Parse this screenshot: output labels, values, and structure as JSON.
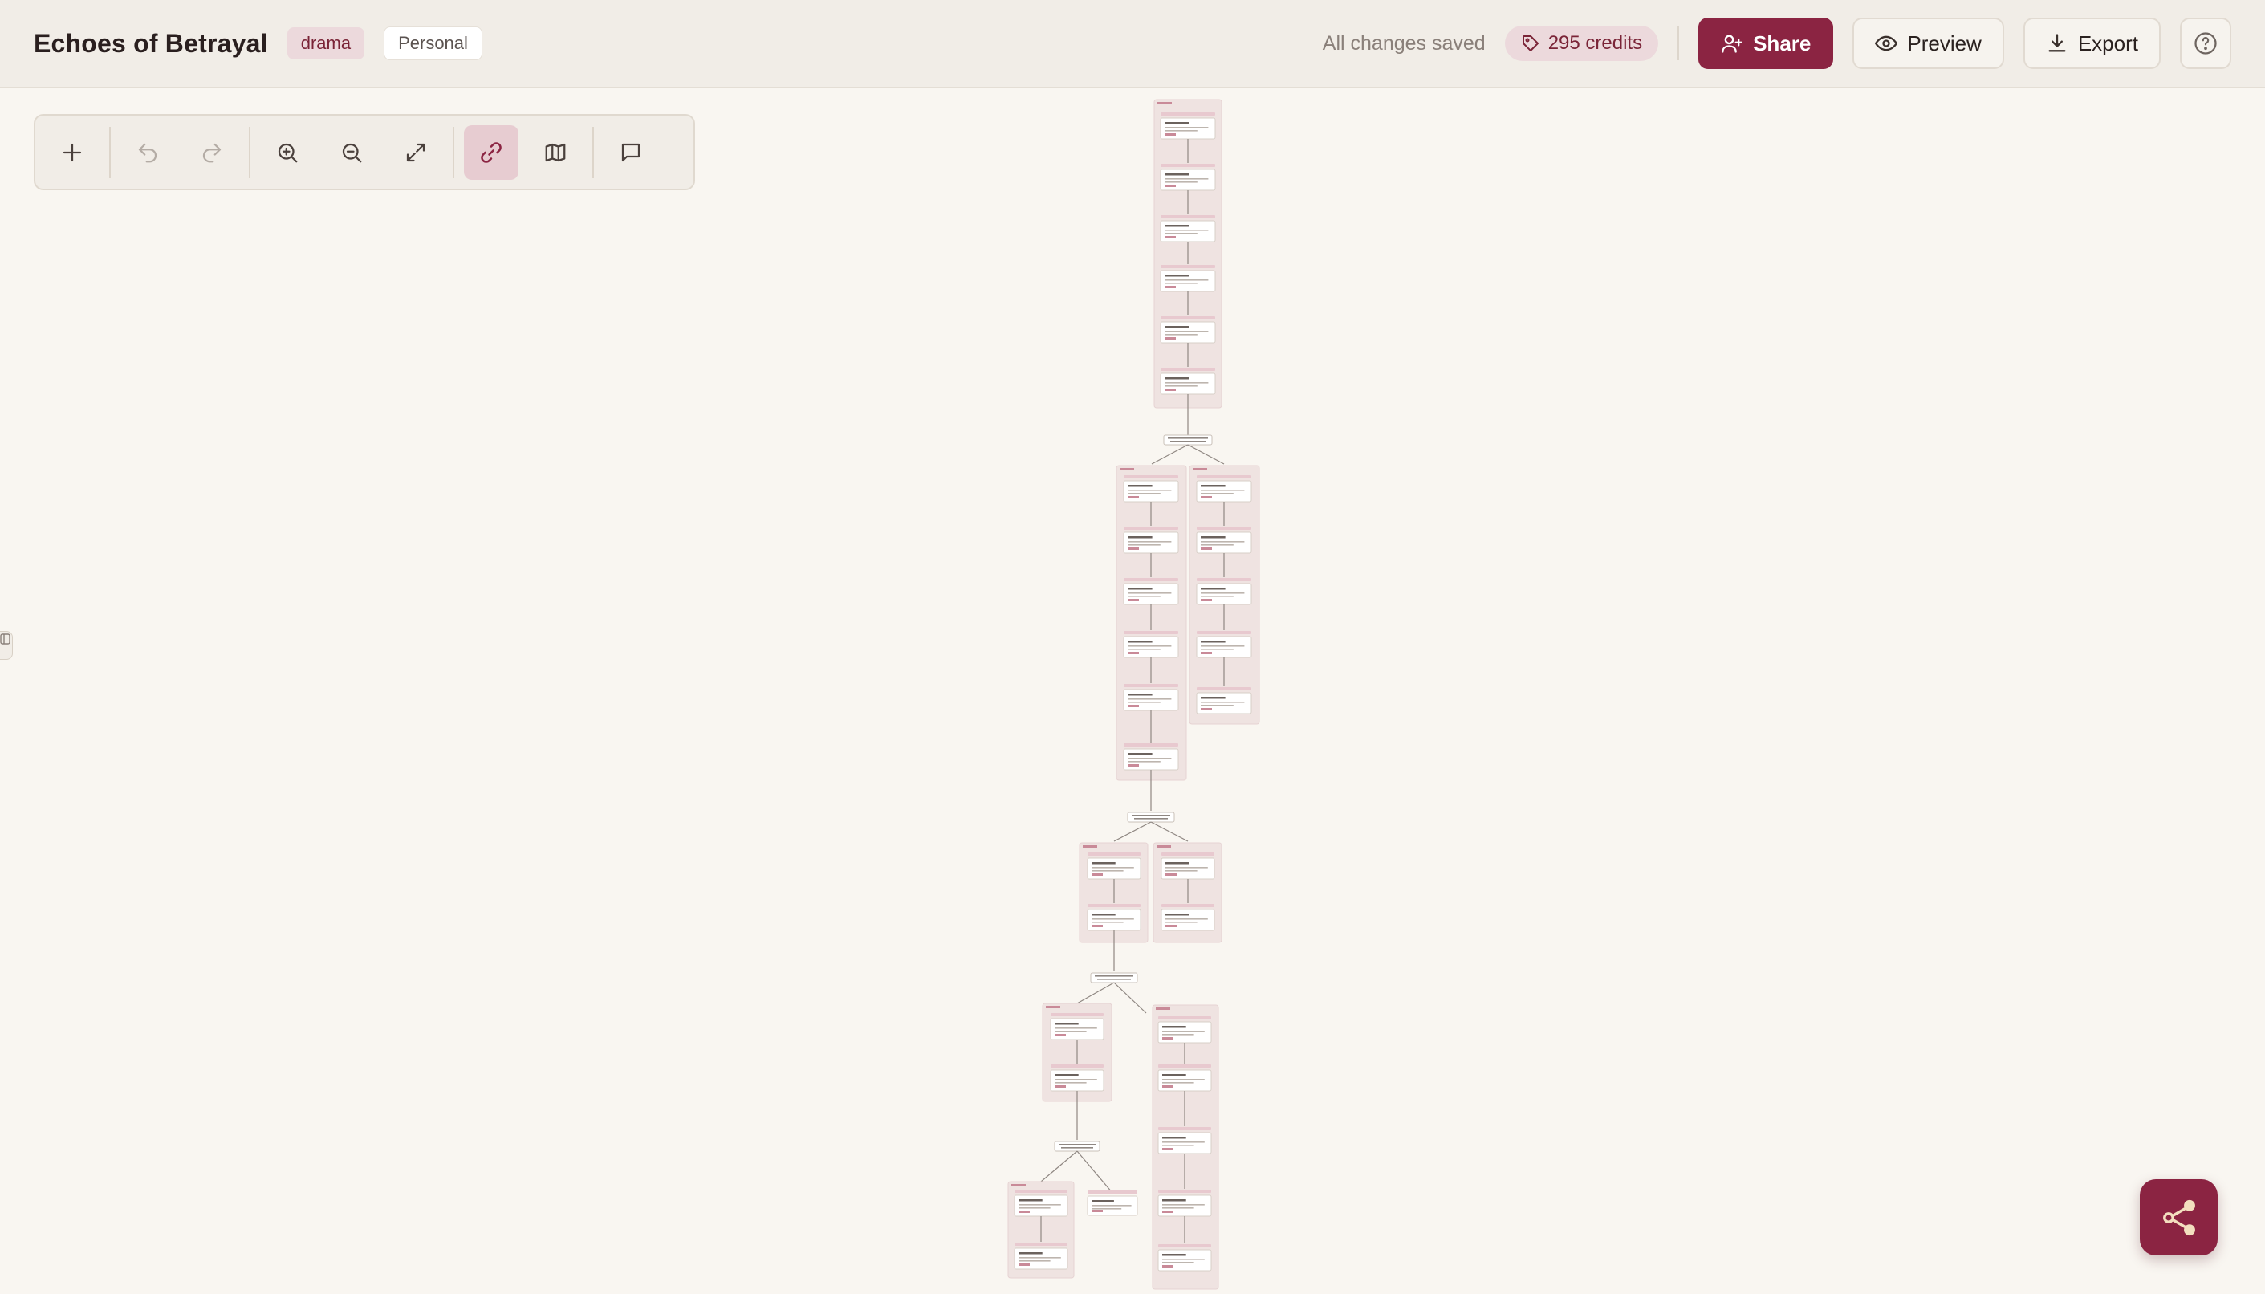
{
  "header": {
    "title": "Echoes of Betrayal",
    "genre_tag": "drama",
    "scope_tag": "Personal",
    "save_status": "All changes saved",
    "credits": "295 credits",
    "share_label": "Share",
    "preview_label": "Preview",
    "export_label": "Export"
  },
  "toolbar": {
    "tools": [
      {
        "name": "add-node-tool",
        "icon": "plus-icon",
        "active": false
      },
      {
        "name": "undo-tool",
        "icon": "undo-icon",
        "active": false
      },
      {
        "name": "redo-tool",
        "icon": "redo-icon",
        "active": false
      },
      {
        "name": "zoom-in-tool",
        "icon": "zoom-in-icon",
        "active": false
      },
      {
        "name": "zoom-out-tool",
        "icon": "zoom-out-icon",
        "active": false
      },
      {
        "name": "fit-view-tool",
        "icon": "expand-icon",
        "active": false
      },
      {
        "name": "connect-tool",
        "icon": "link-icon",
        "active": true
      },
      {
        "name": "minimap-tool",
        "icon": "map-icon",
        "active": false
      },
      {
        "name": "comment-tool",
        "icon": "comment-icon",
        "active": false
      }
    ]
  },
  "colors": {
    "accent": "#8b2442",
    "accent_soft": "#ecd9dc",
    "header_bg": "#f1ede7",
    "canvas_bg": "#f9f6f1",
    "group_bg": "#efe3e1"
  },
  "fab": {
    "icon": "share-nodes-icon"
  }
}
